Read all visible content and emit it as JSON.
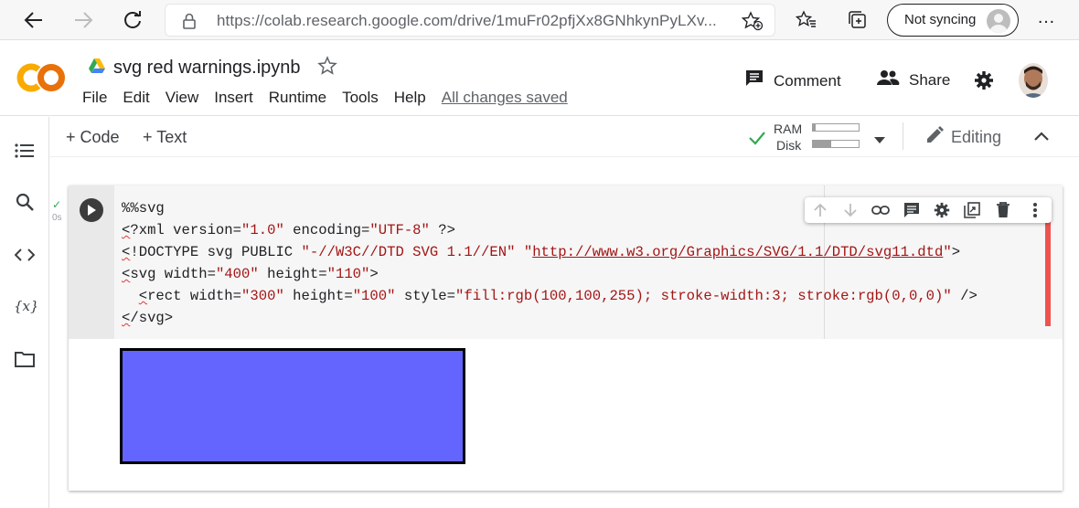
{
  "browser": {
    "url": "https://colab.research.google.com/drive/1muFr02pfjXx8GNhkynPyLXv...",
    "sync_label": "Not syncing",
    "more_label": "…"
  },
  "colab": {
    "logo_text": "CO",
    "notebook_title": "svg red warnings.ipynb",
    "menu": [
      "File",
      "Edit",
      "View",
      "Insert",
      "Runtime",
      "Tools",
      "Help"
    ],
    "save_status": "All changes saved",
    "comment_label": "Comment",
    "share_label": "Share"
  },
  "toolbar": {
    "code_label": "+ Code",
    "text_label": "+ Text",
    "ram_label": "RAM",
    "disk_label": "Disk",
    "ram_usage": 0.05,
    "disk_usage": 0.4,
    "editing_label": "Editing"
  },
  "cell": {
    "exec_status": "✓",
    "exec_time": "0s",
    "code_lines": [
      "%%svg",
      "<?xml version=\"1.0\" encoding=\"UTF-8\" ?>",
      "<!DOCTYPE svg PUBLIC \"-//W3C//DTD SVG 1.1//EN\" \"http://www.w3.org/Graphics/SVG/1.1/DTD/svg11.dtd\">",
      "<svg width=\"400\" height=\"110\">",
      "  <rect width=\"300\" height=\"100\" style=\"fill:rgb(100,100,255); stroke-width:3; stroke:rgb(0,0,0)\" />",
      "</svg>"
    ]
  },
  "output": {
    "rect_fill": "#6464ff",
    "rect_stroke": "#000000"
  },
  "colors": {
    "accent_orange": "#f9ab00",
    "warning_red": "#ef5350"
  }
}
